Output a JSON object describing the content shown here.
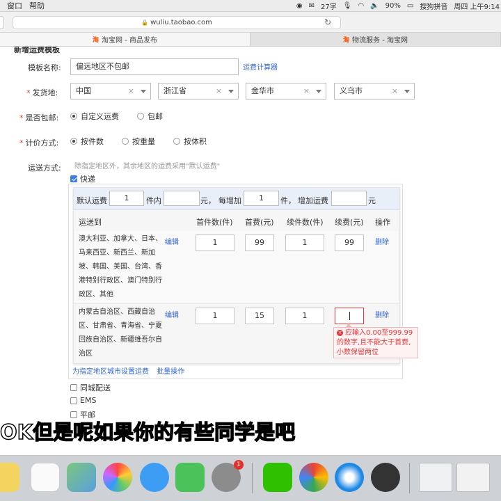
{
  "menubar": {
    "items": [
      "窗口",
      "帮助"
    ],
    "wordcount": "27字",
    "battery": "90%",
    "input_method": "搜狗拼音",
    "clock": "周四 上午9:14"
  },
  "browser": {
    "url": "wuliu.taobao.com",
    "tabs": [
      {
        "label": "淘宝网 - 商品发布",
        "active": true
      },
      {
        "label": "物流服务 - 淘宝网",
        "active": false
      }
    ]
  },
  "form": {
    "page_title": "新增运费模板",
    "template_name_label": "模板名称:",
    "template_name_value": "偏远地区不包邮",
    "freight_calculator": "运费计算器",
    "origin_label": "发货地:",
    "origin": [
      "中国",
      "浙江省",
      "金华市",
      "义乌市"
    ],
    "free_shipping_label": "是否包邮:",
    "free_shipping_options": [
      "自定义运费",
      "包邮"
    ],
    "free_shipping_selected": "自定义运费",
    "pricing_label": "计价方式:",
    "pricing_options": [
      "按件数",
      "按重量",
      "按体积"
    ],
    "pricing_selected": "按件数",
    "shipping_label": "运送方式:",
    "shipping_hint": "除指定地区外，其余地区的运费采用\"默认运费\"",
    "express_label": "快递",
    "express_checked": true,
    "default_bar": {
      "default_label": "默认运费",
      "default_qty": "1",
      "within_label": "件内",
      "default_fee": "",
      "yuan_label": "元，",
      "each_add_label": "每增加",
      "add_qty": "1",
      "unit_label": "件，",
      "add_fee_label": "增加运费",
      "add_fee": "",
      "yuan_end": "元"
    },
    "table": {
      "headers": [
        "运送到",
        "首件数(件)",
        "首费(元)",
        "续件数(件)",
        "续费(元)",
        "操作"
      ],
      "rows": [
        {
          "regions": [
            "澳大利亚、加拿大、日本、",
            "马来西亚、新西兰、新加",
            "坡、韩国、美国、台湾、香",
            "港特别行政区、澳门特别行",
            "政区、其他"
          ],
          "edit": "编辑",
          "first_qty": "1",
          "first_fee": "99",
          "add_qty": "1",
          "add_fee": "99",
          "action": "删除"
        },
        {
          "regions": [
            "内蒙古自治区、西藏自治",
            "区、甘肃省、青海省、宁夏",
            "回族自治区、新疆维吾尔自",
            "治区"
          ],
          "edit": "编辑",
          "first_qty": "1",
          "first_fee": "15",
          "add_qty": "1",
          "add_fee": "",
          "action": "删除"
        }
      ]
    },
    "error_tip": "应输入0.00至999.99的数字,且不能大于首费,小数保留两位",
    "set_city_fee_link": "为指定地区城市设置运费",
    "batch_link": "批量操作",
    "other_methods": [
      "同城配送",
      "EMS",
      "平邮"
    ]
  },
  "subtitle": "OK但是呢如果你的有些同学是吧",
  "dock": {
    "badge_count": "1",
    "apps": [
      "notes-icon",
      "reminders-icon",
      "maps-icon",
      "photos-icon",
      "messages-icon",
      "facetime-icon",
      "system-preferences-icon",
      "wechat-icon",
      "chrome-icon",
      "safari-icon",
      "quicktime-icon",
      "preview-icon"
    ]
  }
}
